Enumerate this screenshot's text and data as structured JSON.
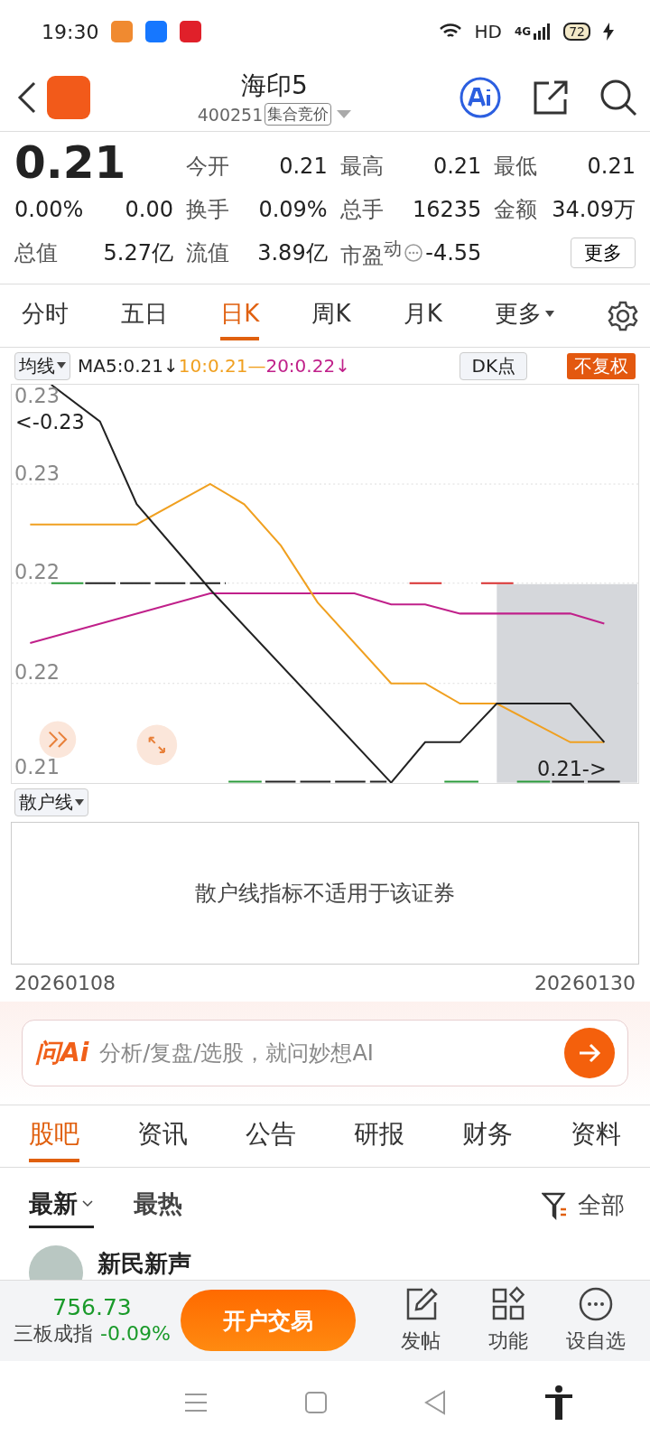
{
  "status_bar": {
    "time": "19:30",
    "network": "HD",
    "network_type": "4G",
    "battery": "72"
  },
  "header": {
    "title": "海印5",
    "code": "400251",
    "tag": "集合竞价"
  },
  "quote": {
    "price": "0.21",
    "change_pct": "0.00%",
    "change": "0.00",
    "total_value_label": "总值",
    "total_value": "5.27亿",
    "fields": [
      {
        "label": "今开",
        "value": "0.21"
      },
      {
        "label": "最高",
        "value": "0.21"
      },
      {
        "label": "最低",
        "value": "0.21"
      },
      {
        "label": "换手",
        "value": "0.09%"
      },
      {
        "label": "总手",
        "value": "16235"
      },
      {
        "label": "金额",
        "value": "34.09万"
      },
      {
        "label": "流值",
        "value": "3.89亿"
      },
      {
        "label": "市盈$^{动}$",
        "value": "-4.55",
        "info": true
      }
    ],
    "more_button": "更多"
  },
  "chart_tabs": [
    {
      "label": "分时",
      "selected": false,
      "kind": "plain"
    },
    {
      "label": "五日",
      "selected": false,
      "kind": "plain"
    },
    {
      "label": "日K",
      "selected": true,
      "kind": "plain"
    },
    {
      "label": "周K",
      "selected": false,
      "kind": "plain"
    },
    {
      "label": "月K",
      "selected": false,
      "kind": "plain"
    },
    {
      "label": "更多",
      "selected": false,
      "kind": "dropdown"
    }
  ],
  "indicator_bar": {
    "selector": "均线",
    "ma_values": [
      {
        "text": "MA5:0.21↓",
        "color": "#222222"
      },
      {
        "text": "10:0.21—",
        "color": "#f0a020"
      },
      {
        "text": "20:0.22↓",
        "color": "#c0208a"
      }
    ],
    "dk_button": "DK点",
    "adjust_badge": "不复权"
  },
  "chart": {
    "y_labels": [
      "0.23",
      "0.23",
      "0.22",
      "0.22",
      "0.21"
    ],
    "left_marker": "<-0.23",
    "right_marker": "0.21->"
  },
  "sub_indicator": {
    "selector": "散户线",
    "message": "散户线指标不适用于该证券"
  },
  "dates": {
    "start": "20260108",
    "end": "20260130"
  },
  "ai_bar": {
    "logo": "问Ai",
    "placeholder": "分析/复盘/选股，就问妙想AI"
  },
  "info_tabs": [
    {
      "label": "股吧",
      "selected": true
    },
    {
      "label": "资讯",
      "selected": false
    },
    {
      "label": "公告",
      "selected": false
    },
    {
      "label": "研报",
      "selected": false
    },
    {
      "label": "财务",
      "selected": false
    },
    {
      "label": "资料",
      "selected": false
    }
  ],
  "sort_tabs": [
    {
      "label": "最新",
      "selected": true
    },
    {
      "label": "最热",
      "selected": false
    }
  ],
  "filter": "全部",
  "post": {
    "author": "新民新声"
  },
  "bottom_bar": {
    "index_value": "756.73",
    "index_name": "三板成指",
    "index_change": "-0.09%",
    "trade_button": "开户交易",
    "actions": [
      {
        "label": "发帖",
        "kind": "post"
      },
      {
        "label": "功能",
        "kind": "apps"
      },
      {
        "label": "设自选",
        "kind": "more"
      }
    ]
  }
}
